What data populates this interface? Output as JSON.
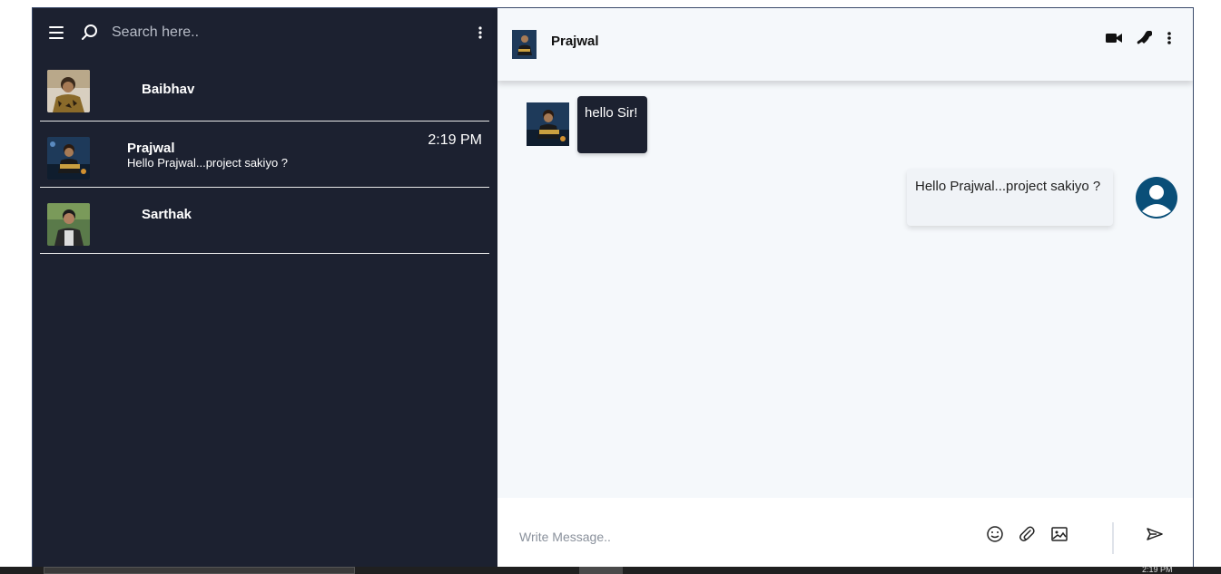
{
  "sidebar": {
    "search": {
      "placeholder": "Search here.."
    },
    "chats": [
      {
        "name": "Baibhav",
        "time": "",
        "preview": ""
      },
      {
        "name": "Prajwal",
        "time": "2:19 PM",
        "preview": "Hello Prajwal...project sakiyo ?"
      },
      {
        "name": "Sarthak",
        "time": "",
        "preview": ""
      }
    ]
  },
  "conversation": {
    "contact_name": "Prajwal",
    "messages": [
      {
        "direction": "incoming",
        "text": "hello Sir!"
      },
      {
        "direction": "outgoing",
        "text": "Hello Prajwal...project sakiyo ?"
      }
    ],
    "composer": {
      "placeholder": "Write Message.."
    }
  },
  "taskbar": {
    "time": "2:19 PM"
  },
  "colors": {
    "sidebar_bg": "#1c2130",
    "chat_bg": "#f5f8fb",
    "user_avatar": "#0a4f78"
  }
}
